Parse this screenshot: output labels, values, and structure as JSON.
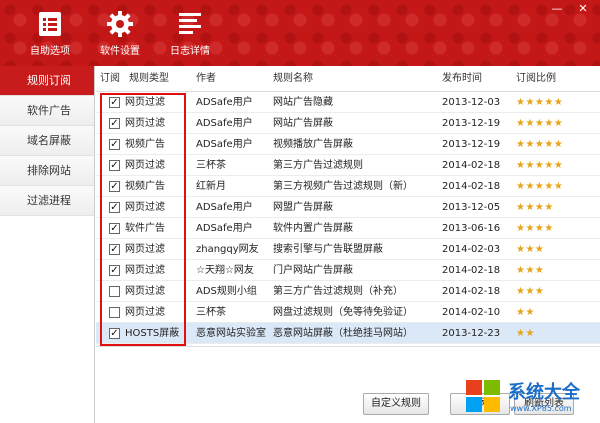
{
  "toolbar": {
    "items": [
      {
        "label": "自助选项",
        "icon": "list-icon"
      },
      {
        "label": "软件设置",
        "icon": "gear-icon"
      },
      {
        "label": "日志详情",
        "icon": "log-icon"
      }
    ]
  },
  "window": {
    "minimize": "—",
    "close": "✕"
  },
  "sidebar": {
    "items": [
      {
        "label": "规则订阅",
        "active": true
      },
      {
        "label": "软件广告",
        "active": false
      },
      {
        "label": "域名屏蔽",
        "active": false
      },
      {
        "label": "排除网站",
        "active": false
      },
      {
        "label": "过滤进程",
        "active": false
      }
    ]
  },
  "table": {
    "headers": {
      "subscribe": "订阅",
      "type": "规则类型",
      "author": "作者",
      "name": "规则名称",
      "date": "发布时间",
      "rating": "订阅比例"
    },
    "rows": [
      {
        "checked": true,
        "type": "网页过滤",
        "author": "ADSafe用户",
        "name": "网站广告隐藏",
        "date": "2013-12-03",
        "rating": "★★★★★"
      },
      {
        "checked": true,
        "type": "网页过滤",
        "author": "ADSafe用户",
        "name": "网站广告屏蔽",
        "date": "2013-12-19",
        "rating": "★★★★★"
      },
      {
        "checked": true,
        "type": "视频广告",
        "author": "ADSafe用户",
        "name": "视频播放广告屏蔽",
        "date": "2013-12-19",
        "rating": "★★★★★"
      },
      {
        "checked": true,
        "type": "网页过滤",
        "author": "三杯茶",
        "name": "第三方广告过滤规则",
        "date": "2014-02-18",
        "rating": "★★★★★"
      },
      {
        "checked": true,
        "type": "视频广告",
        "author": "红新月",
        "name": "第三方视频广告过滤规则（新）",
        "date": "2014-02-18",
        "rating": "★★★★★"
      },
      {
        "checked": true,
        "type": "网页过滤",
        "author": "ADSafe用户",
        "name": "网盟广告屏蔽",
        "date": "2013-12-05",
        "rating": "★★★★"
      },
      {
        "checked": true,
        "type": "软件广告",
        "author": "ADSafe用户",
        "name": "软件内置广告屏蔽",
        "date": "2013-06-16",
        "rating": "★★★★"
      },
      {
        "checked": true,
        "type": "网页过滤",
        "author": "zhangqy网友",
        "name": "搜索引擎与广告联盟屏蔽",
        "date": "2014-02-03",
        "rating": "★★★"
      },
      {
        "checked": true,
        "type": "网页过滤",
        "author": "☆天翔☆网友",
        "name": "门户网站广告屏蔽",
        "date": "2014-02-18",
        "rating": "★★★"
      },
      {
        "checked": false,
        "type": "网页过滤",
        "author": "ADS规则小组",
        "name": "第三方广告过滤规则（补充）",
        "date": "2014-02-18",
        "rating": "★★★"
      },
      {
        "checked": false,
        "type": "网页过滤",
        "author": "三杯茶",
        "name": "网盘过滤规则（免等待免验证）",
        "date": "2014-02-10",
        "rating": "★★"
      },
      {
        "checked": true,
        "type": "HOSTS屏蔽",
        "author": "恶意网站实验室",
        "name": "恶意网站屏蔽（杜绝挂马网站）",
        "date": "2013-12-23",
        "rating": "★★"
      }
    ]
  },
  "buttons": {
    "custom": "自定义规则",
    "add": "添",
    "refresh": "刷新列表"
  },
  "watermark": {
    "title": "系统大全",
    "url": "www.XP85.com"
  }
}
